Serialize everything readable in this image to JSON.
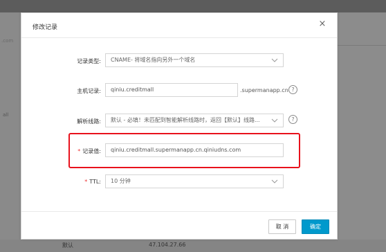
{
  "background": {
    "left_text": ".com",
    "left_text2": "all",
    "bottom_row": {
      "line": "默认",
      "value": "47.104.27.66"
    }
  },
  "modal": {
    "title": "修改记录",
    "close_glyph": "×",
    "fields": {
      "record_type": {
        "label": "记录类型:",
        "value": "CNAME- 将域名指向另外一个域名"
      },
      "host": {
        "label": "主机记录:",
        "value": "qiniu.creditmall",
        "suffix": ".supermanapp.cn",
        "help": "?"
      },
      "line": {
        "label": "解析线路:",
        "value": "默认 - 必填！未匹配到智能解析线路时，返回【默认】线路...",
        "help": "?"
      },
      "record_value": {
        "required_mark": "*",
        "label": "记录值:",
        "value": "qiniu.creditmall.supermanapp.cn.qiniudns.com"
      },
      "ttl": {
        "required_mark": "*",
        "label": "TTL:",
        "value": "10 分钟"
      }
    },
    "buttons": {
      "cancel": "取 消",
      "ok": "确定"
    }
  },
  "colors": {
    "highlight_border": "#e8111c",
    "primary_button": "#0099cc",
    "required_star": "#e33"
  }
}
